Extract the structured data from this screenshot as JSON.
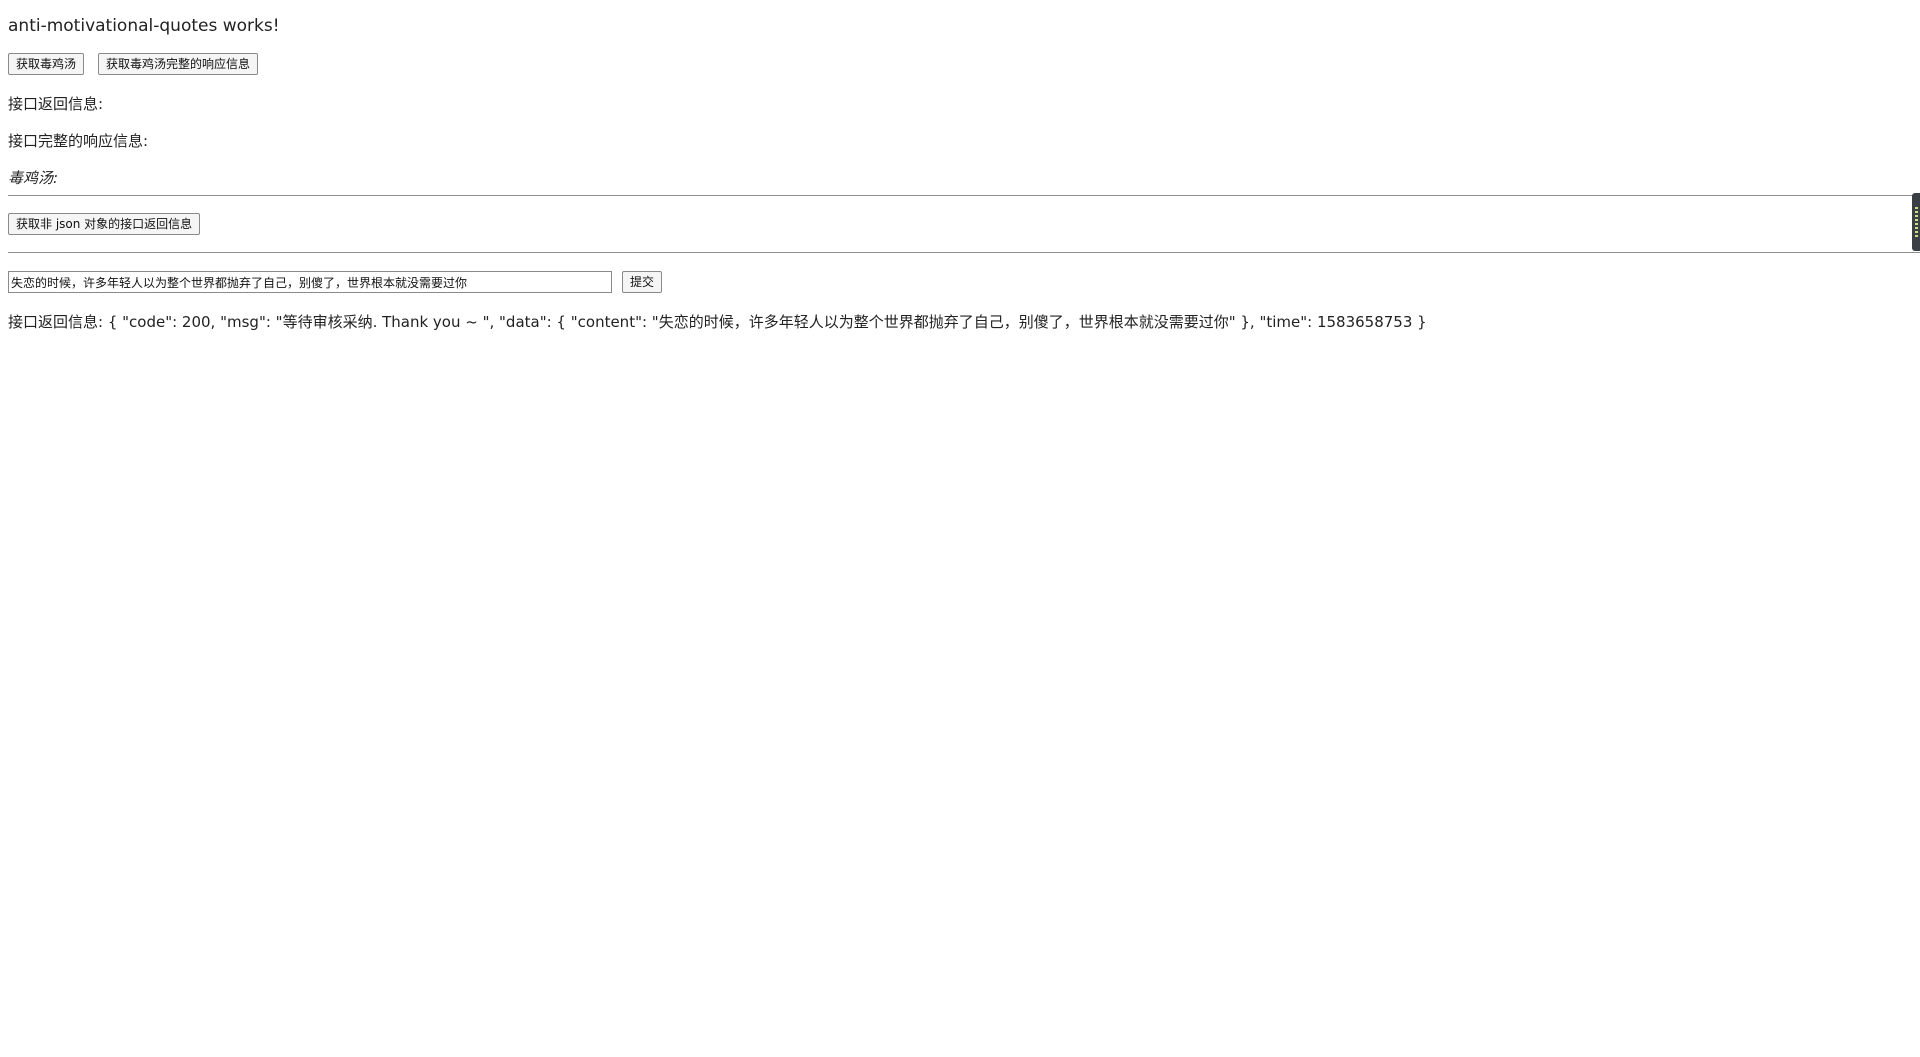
{
  "app": {
    "title": "anti-motivational-quotes works!"
  },
  "toolbar": {
    "get_quote_label": "获取毒鸡汤",
    "get_full_response_label": "获取毒鸡汤完整的响应信息"
  },
  "info": {
    "api_return_label": "接口返回信息:",
    "full_response_label": "接口完整的响应信息:",
    "quote_label": "毒鸡汤:"
  },
  "non_json": {
    "button_label": "获取非 json 对象的接口返回信息"
  },
  "submit_form": {
    "input_value": "失恋的时候，许多年轻人以为整个世界都抛弃了自己，别傻了，世界根本就没需要过你",
    "submit_label": "提交"
  },
  "response": {
    "text": "接口返回信息: { \"code\": 200, \"msg\": \"等待审核采纳. Thank you ~ \", \"data\": { \"content\": \"失恋的时候，许多年轻人以为整个世界都抛弃了自己，别傻了，世界根本就没需要过你\" }, \"time\": 1583658753 }"
  }
}
